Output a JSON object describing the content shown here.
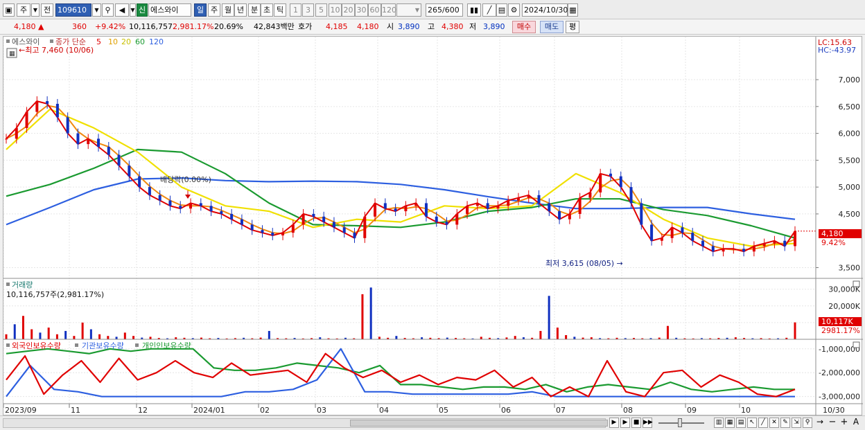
{
  "toolbar": {
    "period_label": "주",
    "prev_label": "전",
    "code": "109610",
    "badge": "신",
    "name": "에스와이",
    "tabs": [
      "일",
      "주",
      "월",
      "년",
      "분",
      "초",
      "틱"
    ],
    "intervals": [
      "1",
      "3",
      "5",
      "10",
      "20",
      "30",
      "60",
      "120"
    ],
    "count": "265",
    "total": "/600",
    "date": "2024/10/30"
  },
  "info": {
    "price": "4,180",
    "up_mark": "▲",
    "change": "360",
    "pct": "+9.42%",
    "volume": "10,116,757",
    "vol_ratio": "2,981.17%",
    "turnover": "20.69%",
    "amount": "42,843백만",
    "quote_label": "호가",
    "ask": "4,185",
    "bid": "4,180",
    "open_label": "시",
    "open": "3,890",
    "high_label": "고",
    "high": "4,380",
    "low_label": "저",
    "low": "3,890",
    "buy_label": "매수",
    "sell_label": "매도",
    "eval_label": "평"
  },
  "chart_data": {
    "type": "candlestick",
    "price_panel": {
      "legend_name": "에스와이",
      "ma_label": "종가 단순",
      "ma_periods": [
        "5",
        "10",
        "20",
        "60",
        "120"
      ],
      "ma_colors": [
        "#e00000",
        "#f08a10",
        "#f0e000",
        "#1a9a30",
        "#2d5fe0"
      ],
      "yticks": [
        "7,000",
        "6,500",
        "6,000",
        "5,500",
        "5,000",
        "4,500",
        "3,500"
      ],
      "ytick_values": [
        7000,
        6500,
        6000,
        5500,
        5000,
        4500,
        3500
      ],
      "ylim": [
        3300,
        7800
      ],
      "lc": "LC:15.63",
      "hc": "HC:-43.97",
      "high_note": "최고 7,460 (10/06)",
      "low_note": "최저 3,615 (08/05)",
      "dividend_note": "배당락(0.00%)",
      "last_price_tag": "4,180",
      "last_pct_tag": "9.42%",
      "last_price": 4180,
      "ma120": [
        4300,
        4620,
        4950,
        5150,
        5170,
        5120,
        5100,
        5110,
        5100,
        5050,
        4950,
        4820,
        4700,
        4600,
        4600,
        4620,
        4620,
        4500,
        4400
      ],
      "ma60": [
        4830,
        5050,
        5350,
        5700,
        5650,
        5250,
        4700,
        4300,
        4280,
        4250,
        4350,
        4550,
        4620,
        4780,
        4780,
        4580,
        4470,
        4280,
        4050
      ],
      "ma20": [
        5700,
        6450,
        6100,
        5650,
        5000,
        4650,
        4550,
        4250,
        4400,
        4350,
        4650,
        4600,
        4650,
        5250,
        4900,
        4400,
        4050,
        3900,
        3950
      ],
      "price_series": [
        5900,
        6100,
        6400,
        6600,
        6550,
        6300,
        6000,
        5800,
        5900,
        5750,
        5600,
        5400,
        5200,
        5000,
        4850,
        4750,
        4650,
        4600,
        4700,
        4650,
        4550,
        4500,
        4400,
        4300,
        4200,
        4150,
        4100,
        4150,
        4300,
        4500,
        4450,
        4350,
        4250,
        4150,
        4050,
        4450,
        4700,
        4600,
        4550,
        4650,
        4700,
        4450,
        4350,
        4300,
        4500,
        4650,
        4700,
        4600,
        4650,
        4750,
        4800,
        4850,
        4700,
        4550,
        4400,
        4500,
        4800,
        4900,
        5250,
        5200,
        5000,
        4700,
        4300,
        4000,
        4050,
        4250,
        4150,
        4000,
        3900,
        3800,
        3850,
        3850,
        3800,
        3900,
        3950,
        4000,
        3900,
        4180
      ]
    },
    "volume_panel": {
      "title": "거래량",
      "current": "10,116,757주(2,981.17%)",
      "yticks": [
        "30,000K",
        "20,000K",
        "10,000K"
      ],
      "ytick_values": [
        30000,
        20000,
        10000
      ],
      "ylim": [
        0,
        34000
      ],
      "last_tag": "10,117K",
      "last_pct": "2981.17%",
      "values": [
        3000,
        9000,
        14000,
        6000,
        4000,
        7000,
        3000,
        5000,
        2000,
        10000,
        6000,
        3000,
        2000,
        1500,
        4000,
        2000,
        1000,
        1500,
        800,
        600,
        1200,
        900,
        700,
        1000,
        600,
        800,
        500,
        700,
        900,
        600,
        1000,
        5000,
        700,
        600,
        800,
        500,
        700,
        1200,
        600,
        500,
        900,
        600,
        27000,
        31000,
        1500,
        900,
        2000,
        800,
        600,
        1200,
        900,
        700,
        1000,
        800,
        600,
        500,
        1500,
        900,
        700,
        1100,
        2000,
        1200,
        900,
        5000,
        26000,
        7000,
        2500,
        1500,
        1000,
        1200,
        700,
        600,
        900,
        700,
        800,
        600,
        700,
        1000,
        8000,
        900,
        600,
        500,
        700,
        600,
        800,
        900,
        1200,
        800,
        600,
        700,
        500,
        600,
        900,
        10117
      ]
    },
    "holder_panel": {
      "legend": [
        "외국인보유수량",
        "기관보유수량",
        "개인인보유수량"
      ],
      "legend_colors": [
        "#e00000",
        "#2d5fe0",
        "#1a9a30"
      ],
      "yticks": [
        "-1,000,000",
        "-2,000,000",
        "-3,000,000"
      ],
      "ytick_values": [
        -1000000,
        -2000000,
        -3000000
      ],
      "ylim": [
        -3300000,
        -600000
      ],
      "foreign": [
        -2300000,
        -1300000,
        -2900000,
        -2100000,
        -1500000,
        -2400000,
        -1400000,
        -2300000,
        -2000000,
        -1500000,
        -2000000,
        -2200000,
        -1600000,
        -2100000,
        -2000000,
        -1900000,
        -2400000,
        -1200000,
        -1800000,
        -2200000,
        -1900000,
        -2400000,
        -2100000,
        -2500000,
        -2200000,
        -2300000,
        -1900000,
        -2600000,
        -2200000,
        -3000000,
        -2600000,
        -3000000,
        -1500000,
        -2800000,
        -3000000,
        -2000000,
        -1900000,
        -2600000,
        -2100000,
        -2400000,
        -2900000,
        -3000000,
        -2700000
      ],
      "institution": [
        -3000000,
        -1700000,
        -2700000,
        -2800000,
        -3000000,
        -3000000,
        -3000000,
        -3000000,
        -3000000,
        -3000000,
        -2800000,
        -2800000,
        -2700000,
        -2300000,
        -1000000,
        -2800000,
        -2800000,
        -2900000,
        -2900000,
        -2900000,
        -2900000,
        -2900000,
        -2800000,
        -3000000,
        -3000000,
        -3000000,
        -3000000,
        -3000000,
        -3000000,
        -3000000,
        -3000000,
        -3000000,
        -3000000,
        -3000000
      ],
      "individual": [
        -1200000,
        -1100000,
        -1000000,
        -1100000,
        -1200000,
        -1000000,
        -1100000,
        -1000000,
        -1000000,
        -1000000,
        -1800000,
        -1900000,
        -1900000,
        -1800000,
        -1600000,
        -1700000,
        -1800000,
        -2000000,
        -1700000,
        -2500000,
        -2500000,
        -2600000,
        -2700000,
        -2600000,
        -2600000,
        -2700000,
        -2500000,
        -2800000,
        -2600000,
        -2500000,
        -2600000,
        -2700000,
        -2400000,
        -2700000,
        -2800000,
        -2700000,
        -2600000,
        -2700000,
        -2700000
      ]
    },
    "xticks": [
      "2023/09",
      "11",
      "12",
      "2024/01",
      "02",
      "03",
      "04",
      "05",
      "06",
      "07",
      "08",
      "09",
      "10",
      "10/30"
    ]
  }
}
